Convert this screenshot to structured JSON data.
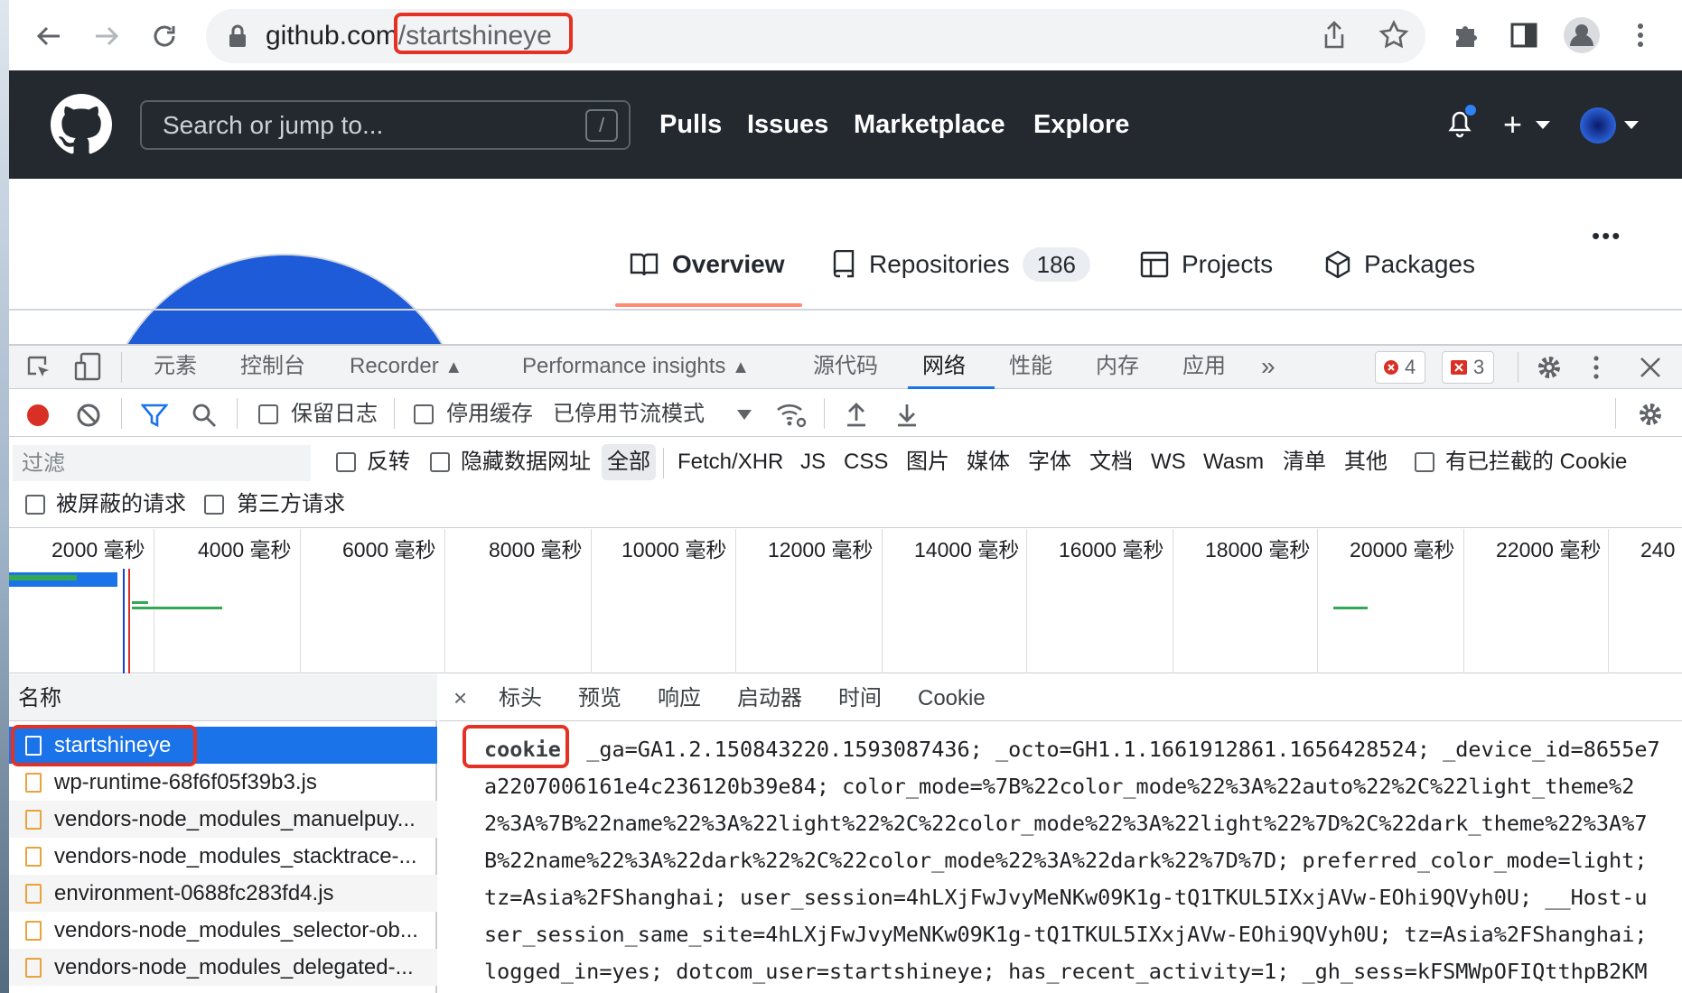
{
  "browser": {
    "url_host": "github.com",
    "url_path": "/startshineye"
  },
  "github": {
    "search_placeholder": "Search or jump to...",
    "search_shortcut": "/",
    "nav": [
      "Pulls",
      "Issues",
      "Marketplace",
      "Explore"
    ],
    "plus_label": "+"
  },
  "profile": {
    "more": "•••",
    "tabs": {
      "overview": "Overview",
      "repositories": "Repositories",
      "repositories_count": "186",
      "projects": "Projects",
      "packages": "Packages"
    }
  },
  "devtools": {
    "tabs": [
      "元素",
      "控制台",
      "Recorder",
      "Performance insights",
      "源代码",
      "网络",
      "性能",
      "内存",
      "应用"
    ],
    "active_tab": "网络",
    "more_tabs": "»",
    "errors_count": "4",
    "issues_count": "3",
    "toolbar": {
      "preserve_log": "保留日志",
      "disable_cache": "停用缓存",
      "throttling": "已停用节流模式"
    },
    "filter": {
      "placeholder": "过滤",
      "invert": "反转",
      "hide_data_urls": "隐藏数据网址",
      "all": "全部",
      "types": [
        "Fetch/XHR",
        "JS",
        "CSS",
        "图片",
        "媒体",
        "字体",
        "文档",
        "WS",
        "Wasm",
        "清单",
        "其他"
      ],
      "blocked_cookies": "有已拦截的 Cookie",
      "blocked_requests": "被屏蔽的请求",
      "third_party": "第三方请求"
    },
    "timeline_labels": [
      "2000 毫秒",
      "4000 毫秒",
      "6000 毫秒",
      "8000 毫秒",
      "10000 毫秒",
      "12000 毫秒",
      "14000 毫秒",
      "16000 毫秒",
      "18000 毫秒",
      "20000 毫秒",
      "22000 毫秒",
      "240"
    ],
    "requests_header": "名称",
    "requests": [
      "startshineye",
      "wp-runtime-68f6f05f39b3.js",
      "vendors-node_modules_manuelpuy...",
      "vendors-node_modules_stacktrace-...",
      "environment-0688fc283fd4.js",
      "vendors-node_modules_selector-ob...",
      "vendors-node_modules_delegated-..."
    ],
    "detail_close": "×",
    "detail_tabs": [
      "标头",
      "预览",
      "响应",
      "启动器",
      "时间",
      "Cookie"
    ],
    "cookie_key": "cookie:",
    "cookie_lines": [
      "_ga=GA1.2.150843220.1593087436; _octo=GH1.1.1661912861.1656428524; _device_id=8655e7",
      "a2207006161e4c236120b39e84; color_mode=%7B%22color_mode%22%3A%22auto%22%2C%22light_theme%2",
      "2%3A%7B%22name%22%3A%22light%22%2C%22color_mode%22%3A%22light%22%7D%2C%22dark_theme%22%3A%7",
      "B%22name%22%3A%22dark%22%2C%22color_mode%22%3A%22dark%22%7D%7D; preferred_color_mode=light;",
      "tz=Asia%2FShanghai; user_session=4hLXjFwJvyMeNKw09K1g-tQ1TKUL5IXxjAVw-EOhi9QVyh0U; __Host-u",
      "ser_session_same_site=4hLXjFwJvyMeNKw09K1g-tQ1TKUL5IXxjAVw-EOhi9QVyh0U; tz=Asia%2FShanghai;",
      "logged_in=yes; dotcom_user=startshineye; has_recent_activity=1; _gh_sess=kFSMWpOFIQtthpB2KM"
    ]
  },
  "colors": {
    "highlight_box": "#e53124",
    "github_header": "#24292f",
    "selected_row": "#1a73e8"
  }
}
